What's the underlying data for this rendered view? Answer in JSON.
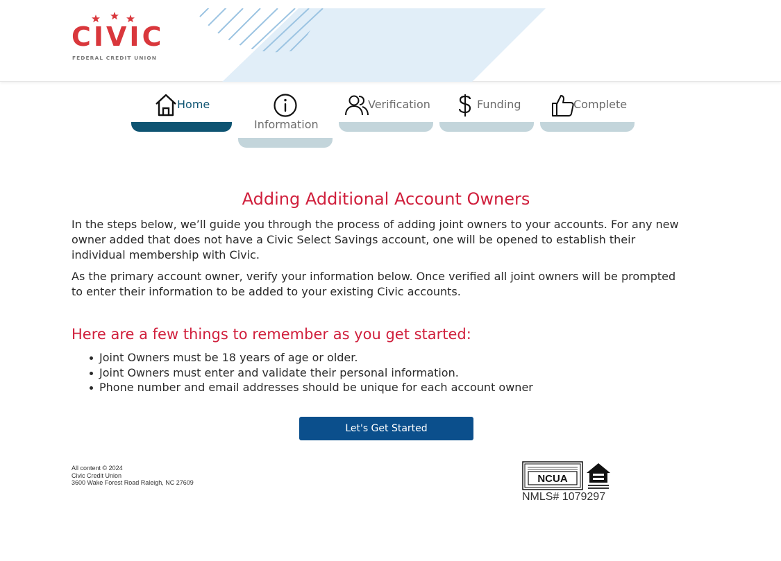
{
  "brand": {
    "logo_word": "CIVIC",
    "logo_tagline": "FEDERAL CREDIT UNION",
    "primary_color": "#d9373c"
  },
  "steps": [
    {
      "label": "Home",
      "icon": "home-icon",
      "state": "active"
    },
    {
      "label": "Information",
      "icon": "info-icon",
      "state": "current"
    },
    {
      "label": "Verification",
      "icon": "users-icon",
      "state": "upcoming"
    },
    {
      "label": "Funding",
      "icon": "dollar-icon",
      "state": "upcoming"
    },
    {
      "label": "Complete",
      "icon": "thumbs-up-icon",
      "state": "upcoming"
    }
  ],
  "main": {
    "title": "Adding Additional Account Owners",
    "paragraphs": [
      "In the steps below, we’ll guide you through the process of adding joint owners to your accounts. For any new owner added that does not have a Civic Select Savings account, one will be opened to establish their individual membership with Civic.",
      "As the primary account owner, verify your information below. Once verified all joint owners will be prompted to enter their information to be added to your existing Civic accounts."
    ],
    "subtitle": "Here are a few things to remember as you get started:",
    "bullets": [
      "Joint Owners must be 18 years of age or older.",
      "Joint Owners must enter and validate their personal information.",
      "Phone number and email addresses should be unique for each account owner"
    ],
    "cta_label": "Let's Get Started"
  },
  "footer": {
    "copyright": "All content © 2024",
    "org_name": "Civic Credit Union",
    "address": "3600 Wake Forest Road Raleigh, NC 27609",
    "ncua_text": "NCUA",
    "nmls": "NMLS# 1079297"
  },
  "colors": {
    "accent_red": "#d01f3c",
    "active_bar": "#0e5472",
    "inactive_bar": "#c3d5db",
    "button_blue": "#0b4f8c"
  }
}
